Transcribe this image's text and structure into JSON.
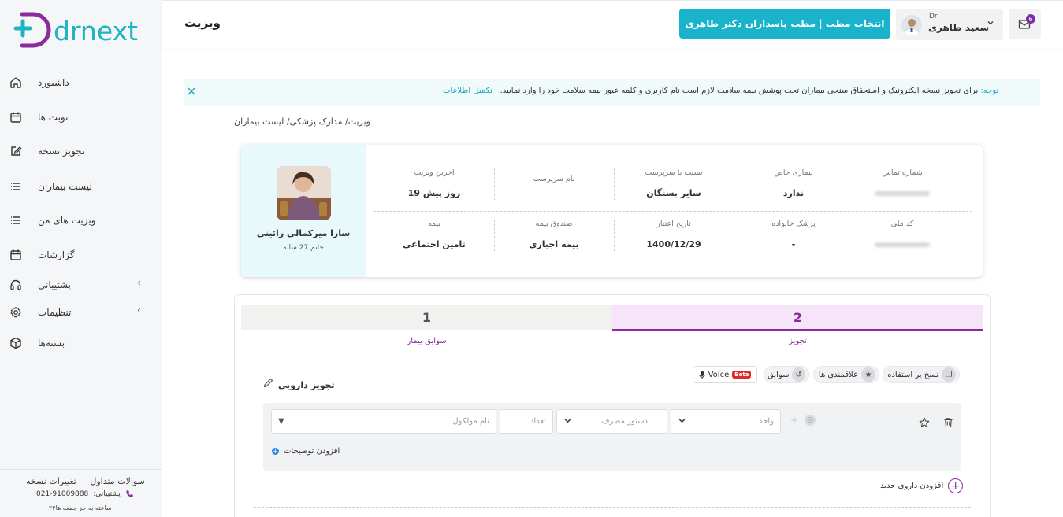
{
  "app": {
    "logo_text": "drnext"
  },
  "colors": {
    "accent": "#19b4cc",
    "brand_purple": "#8b2b9d",
    "logo_teal": "#1fb4c4"
  },
  "sidebar": {
    "items": [
      {
        "label": "داشبورد",
        "icon": "home-icon"
      },
      {
        "label": "نوبت ها",
        "icon": "calendar-icon"
      },
      {
        "label": "تجویز نسخه",
        "icon": "edit-icon"
      },
      {
        "label": "لیست بیماران",
        "icon": "list-icon"
      },
      {
        "label": "ویزیت های من",
        "icon": "list-icon"
      },
      {
        "label": "گزارشات",
        "icon": "calendar-icon"
      },
      {
        "label": "پشتیبانی",
        "icon": "headset-icon"
      },
      {
        "label": "تنظیمات",
        "icon": "gear-icon"
      },
      {
        "label": "بسته‌ها",
        "icon": "box-icon"
      }
    ],
    "footer": {
      "faq": "سوالات متداول",
      "changes": "تغییرات نسخه",
      "support_label": ":پشتیبانی",
      "support_phone": "021-91009888",
      "hours": "۲۴ساعته به جز جمعه ها"
    }
  },
  "header": {
    "page_title": "ویزیت",
    "office_button": "انتخاب مطب | مطب پاسداران دکتر طاهری",
    "user_prefix": "Dr",
    "user_name": "سعید طاهری",
    "mail_count": "6"
  },
  "notice": {
    "label": "توجه:",
    "text": "برای تجویز نسخه الکترونیک و استحقاق سنجی بیماران تحت پوشش بیمه سلامت لازم است نام کاربری و کلمه عبور بیمه سلامت خود را وارد نمایید.",
    "link": "تکمیل اطلاعات"
  },
  "breadcrumb": "ویزیت/ مدارک پزشکی/ لیست بیماران",
  "patient": {
    "name": "سارا میرکمالی رائینی",
    "meta": "خانم 27 ساله",
    "fields": {
      "phone_label": "شماره تماس",
      "special_disease_label": "بیماری خاص",
      "special_disease": "ندارد",
      "relation_label": "نسبت با سرپرست",
      "relation": "سایر بستگان",
      "guardian_label": "نام سرپرست",
      "last_visit_label": "آخرین ویزیت",
      "last_visit": "19 روز پیش",
      "national_id_label": "کد ملی",
      "family_doctor_label": "پزشک خانواده",
      "family_doctor": "-",
      "expiry_label": "تاریخ اعتبار",
      "expiry": "1400/12/29",
      "fund_label": "صندوق بیمه",
      "fund": "بیمه اجباری",
      "insurance_label": "بیمه",
      "insurance": "تامین اجتماعی"
    }
  },
  "steps": [
    {
      "number": "1",
      "label": "سوابق بیمار"
    },
    {
      "number": "2",
      "label": "تجویز"
    }
  ],
  "prescription": {
    "title": "تجویز دارویی",
    "tools": {
      "frequent": "نسخ پر استفاده",
      "favorites": "علاقمندی ها",
      "history": "سوابق",
      "voice": "Voice",
      "beta": "Beta"
    },
    "drug_row": {
      "unit_placeholder": "واحد",
      "dosage_placeholder": "دستور مصرف",
      "count_placeholder": "تعداد",
      "molecule_placeholder": "نام مولکول",
      "add_note": "افزودن توضیحات"
    },
    "add_drug": "افزودن داروی جدید"
  }
}
